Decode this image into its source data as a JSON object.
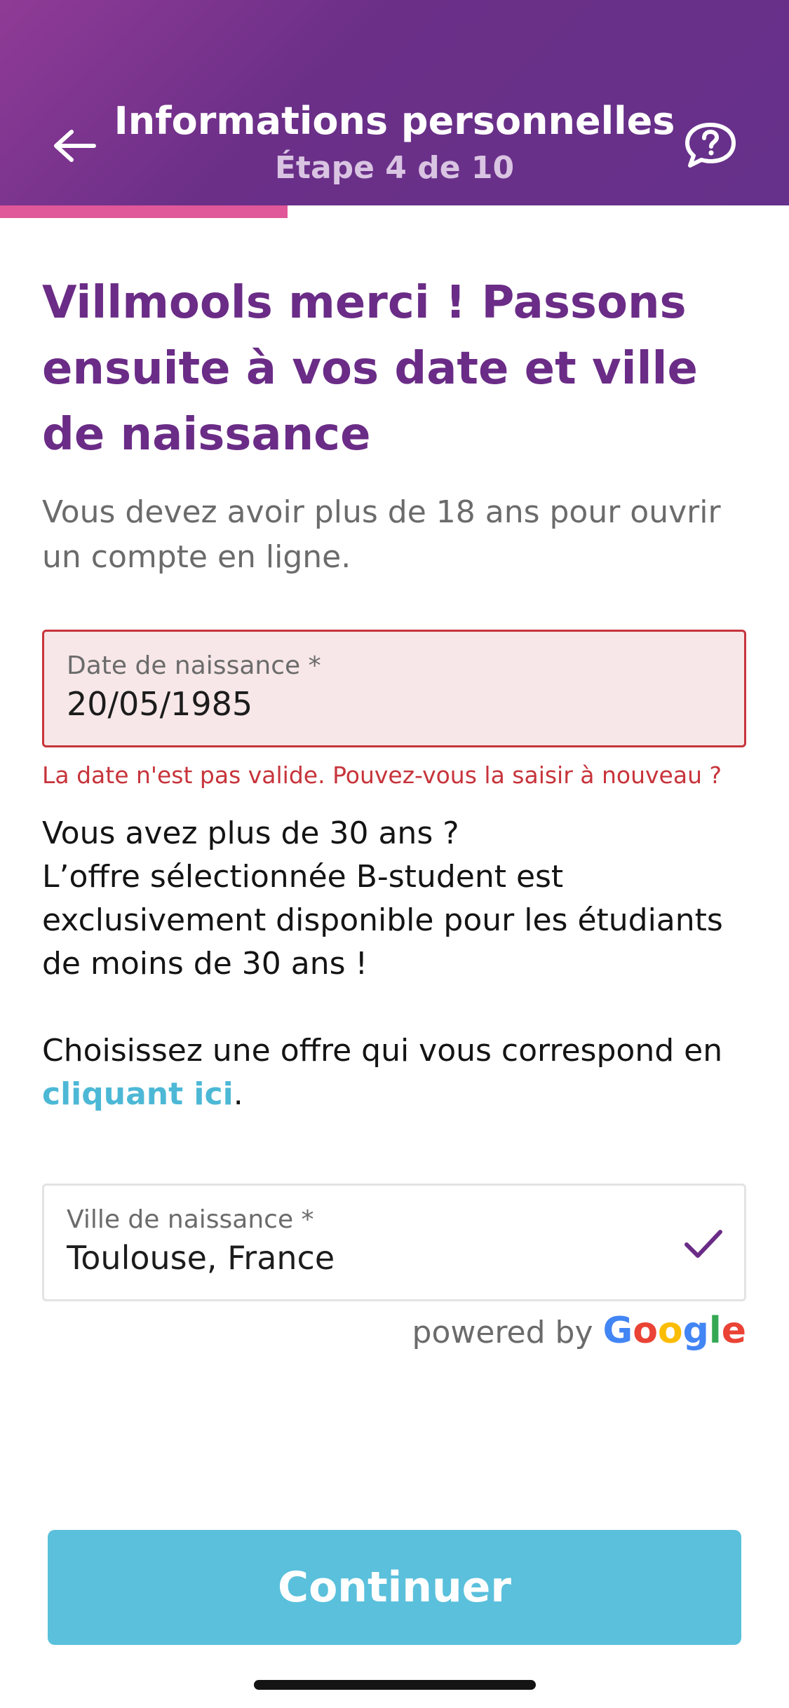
{
  "header": {
    "title": "Informations personnelles",
    "step_label": "Étape 4 de 10",
    "back_icon": "arrow-left-icon",
    "help_icon": "help-chat-icon",
    "progress": 0.364
  },
  "main": {
    "title": "Villmools merci ! Passons ensuite à vos date et ville de naissance",
    "subtitle": "Vous devez avoir plus de 18 ans pour ouvrir un compte en ligne."
  },
  "birth_date_field": {
    "label": "Date de naissance *",
    "value": "20/05/1985",
    "error": "La date n'est pas valide. Pouvez-vous la saisir à nouveau ?"
  },
  "age_info": {
    "line1": "Vous avez plus de 30 ans ?",
    "line2": "L’offre sélectionnée B-student est exclusivement disponible pour les étudiants de moins de 30 ans !",
    "choose_text": "Choisissez une offre qui vous correspond en ",
    "link_text": "cliquant ici",
    "period": "."
  },
  "birth_city_field": {
    "label": "Ville de naissance *",
    "value": "Toulouse, France",
    "status_icon": "checkmark-icon"
  },
  "powered_by": {
    "text": "powered by",
    "brand": "Google"
  },
  "footer": {
    "continue_label": "Continuer"
  },
  "colors": {
    "header_purple": "#6b2f88",
    "title_purple": "#6a2c86",
    "progress_pink": "#e0579a",
    "error_red": "#c7343b",
    "link_blue": "#4db8d6",
    "button_blue": "#5ac0dc"
  }
}
